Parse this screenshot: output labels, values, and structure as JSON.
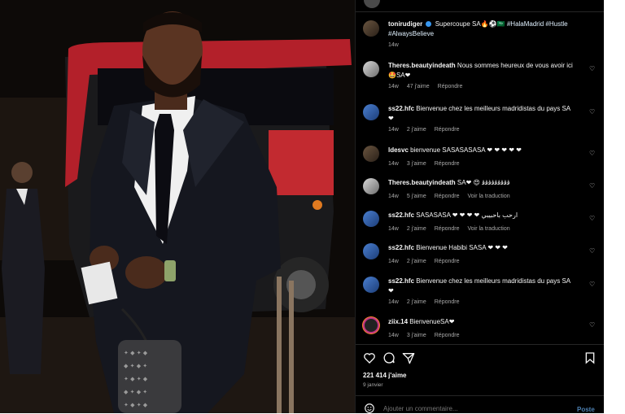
{
  "post": {
    "author": "tonirudiger",
    "caption": "Supercoupe SA🔥⚽🇸🇦",
    "hashtags": "#HalaMadrid #Hustle #AlwaysBelieve",
    "time": "14w",
    "likes": "221 414 j'aime",
    "date": "9 janvier",
    "comment_placeholder": "Ajouter un commentaire...",
    "post_button": "Poste"
  },
  "comments": [
    {
      "user": "Theres.beautyindeath",
      "text": "Nous sommes heureux de vous avoir ici 🤩SA❤",
      "time": "14w",
      "likes": "47 j'aime",
      "reply": "Répondre",
      "translate": ""
    },
    {
      "user": "ss22.hfc",
      "text": "Bienvenue chez les meilleurs madridistas du pays SA ❤",
      "time": "14w",
      "likes": "2 j'aime",
      "reply": "Répondre",
      "translate": ""
    },
    {
      "user": "ldesvc",
      "text": "bienvenue SASASASASA ❤ ❤ ❤ ❤ ❤",
      "time": "14w",
      "likes": "3 j'aime",
      "reply": "Répondre",
      "translate": ""
    },
    {
      "user": "Theres.beautyindeath",
      "text": "SA❤ 😍 ﭬﭬﭬﭬﭬﭬﭬﭬﭬ",
      "time": "14w",
      "likes": "5 j'aime",
      "reply": "Répondre",
      "translate": "Voir la traduction"
    },
    {
      "user": "ss22.hfc",
      "text": "SASASASA ❤ ❤ ❤ ❤ ارحب باحبيبي",
      "time": "14w",
      "likes": "2 j'aime",
      "reply": "Répondre",
      "translate": "Voir la traduction"
    },
    {
      "user": "ss22.hfc",
      "text": "Bienvenue Habibi SASA ❤ ❤ ❤",
      "time": "14w",
      "likes": "2 j'aime",
      "reply": "Répondre",
      "translate": ""
    },
    {
      "user": "ss22.hfc",
      "text": "Bienvenue chez les meilleurs madridistas du pays SA ❤",
      "time": "14w",
      "likes": "2 j'aime",
      "reply": "Répondre",
      "translate": ""
    },
    {
      "user": "ziix.14",
      "text": "BienvenueSA❤",
      "time": "14w",
      "likes": "3 j'aime",
      "reply": "Répondre",
      "translate": ""
    }
  ],
  "icons": {
    "like": "heart-icon",
    "comment": "comment-icon",
    "share": "share-icon",
    "save": "bookmark-icon",
    "emoji": "emoji-icon",
    "verified": "verified-badge-icon"
  },
  "colors": {
    "background": "#000000",
    "text": "#f5f5f5",
    "muted": "#a8a8a8",
    "link_blue": "#4c7fb0",
    "heart_red": "#ed4956"
  }
}
